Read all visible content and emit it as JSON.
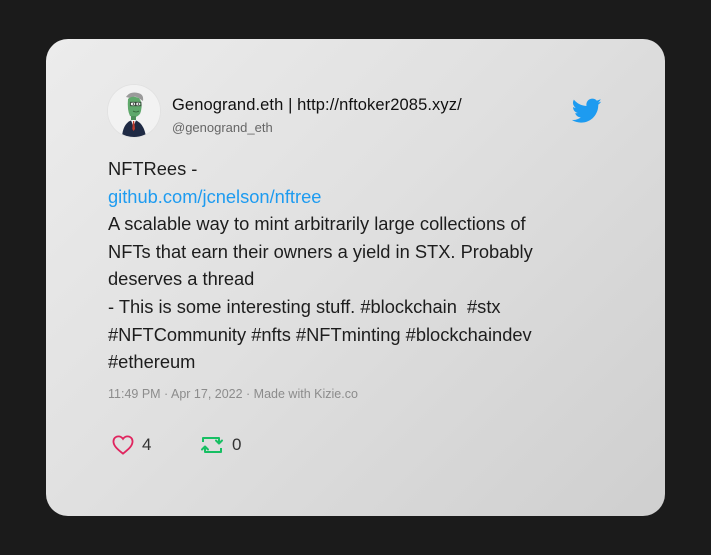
{
  "user": {
    "display_name": "Genogrand.eth | http://nftoker2085.xyz/",
    "handle": "@genogrand_eth",
    "avatar_icon": "nft-character-avatar"
  },
  "brand_icon": "twitter-bird-icon",
  "colors": {
    "link": "#1d9bf0",
    "twitter_blue": "#1d9bf0",
    "like_red": "#e0245e",
    "retweet_green": "#17bf63"
  },
  "tweet": {
    "lines": [
      "NFTRees -",
      "github.com/jcnelson/nftree",
      "A scalable way to mint arbitrarily large collections of",
      "NFTs that earn their owners a yield in STX. Probably",
      "deserves a thread",
      "- This is some interesting stuff. #blockchain  #stx",
      "#NFTCommunity #nfts #NFTminting #blockchaindev",
      "#ethereum"
    ]
  },
  "meta": "11:49 PM · Apr 17, 2022 · Made with Kizie.co",
  "actions": {
    "likes": "4",
    "retweets": "0"
  }
}
